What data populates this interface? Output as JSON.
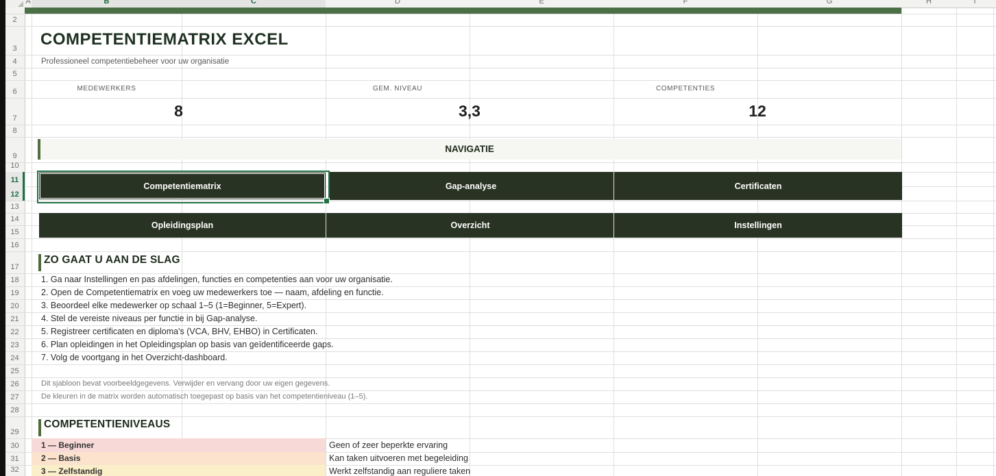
{
  "colors": {
    "selection_green": "#1e7145",
    "top_band_green": "#4c7046",
    "nav_button_green": "#293323",
    "section_accent_green": "#52703d",
    "level1_bg": "#f7d9d8",
    "level2_bg": "#fbe3cd",
    "level3_bg": "#faefc8"
  },
  "grid": {
    "columns": [
      "A",
      "B",
      "C",
      "D",
      "E",
      "F",
      "G",
      "H",
      "I"
    ],
    "rows": [
      "2",
      "3",
      "4",
      "5",
      "6",
      "7",
      "8",
      "9",
      "10",
      "11",
      "12",
      "13",
      "14",
      "15",
      "16",
      "17",
      "18",
      "19",
      "20",
      "21",
      "22",
      "23",
      "24",
      "25",
      "26",
      "27",
      "28",
      "29",
      "30",
      "31",
      "32"
    ],
    "selected_columns": "B:C",
    "selected_rows": "11:12"
  },
  "header": {
    "title": "COMPETENTIEMATRIX EXCEL",
    "subtitle": "Professioneel competentiebeheer voor uw organisatie"
  },
  "stats": [
    {
      "label": "MEDEWERKERS",
      "value": "8"
    },
    {
      "label": "GEM. NIVEAU",
      "value": "3,3"
    },
    {
      "label": "COMPETENTIES",
      "value": "12"
    }
  ],
  "navigation": {
    "heading": "NAVIGATIE",
    "buttons": [
      "Competentiematrix",
      "Gap-analyse",
      "Certificaten",
      "Opleidingsplan",
      "Overzicht",
      "Instellingen"
    ]
  },
  "getting_started": {
    "heading": "ZO GAAT U AAN DE SLAG",
    "steps": [
      "1. Ga naar Instellingen en pas afdelingen, functies en competenties aan voor uw organisatie.",
      "2. Open de Competentiematrix en voeg uw medewerkers toe — naam, afdeling en functie.",
      "3. Beoordeel elke medewerker op schaal 1–5 (1=Beginner, 5=Expert).",
      "4. Stel de vereiste niveaus per functie in bij Gap-analyse.",
      "5. Registreer certificaten en diploma's (VCA, BHV, EHBO) in Certificaten.",
      "6. Plan opleidingen in het Opleidingsplan op basis van geïdentificeerde gaps.",
      "7. Volg de voortgang in het Overzicht-dashboard."
    ],
    "notes": [
      "Dit sjabloon bevat voorbeeldgegevens. Verwijder en vervang door uw eigen gegevens.",
      "De kleuren in de matrix worden automatisch toegepast op basis van het competentieniveau (1–5)."
    ]
  },
  "levels": {
    "heading": "COMPETENTIENIVEAUS",
    "items": [
      {
        "label": "1 — Beginner",
        "description": "Geen of zeer beperkte ervaring"
      },
      {
        "label": "2 — Basis",
        "description": "Kan taken uitvoeren met begeleiding"
      },
      {
        "label": "3 — Zelfstandig",
        "description": "Werkt zelfstandig aan reguliere taken"
      }
    ]
  }
}
